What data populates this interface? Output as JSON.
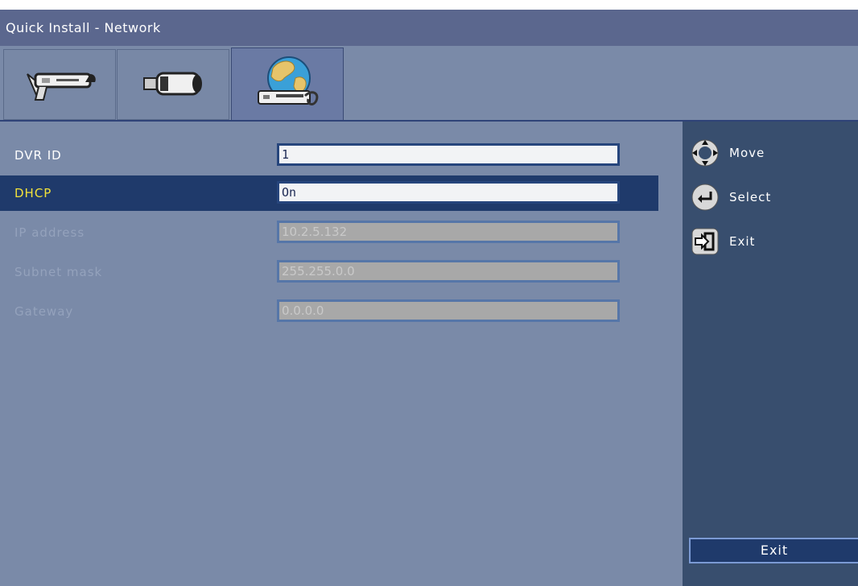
{
  "window": {
    "title": "Quick Install - Network"
  },
  "tabs": [
    {
      "icon": "wrench-dvr-icon",
      "active": false
    },
    {
      "icon": "camera-icon",
      "active": false
    },
    {
      "icon": "globe-network-icon",
      "active": true
    }
  ],
  "form": {
    "rows": [
      {
        "label": "DVR ID",
        "value": "1",
        "state": "normal"
      },
      {
        "label": "DHCP",
        "value": "On",
        "state": "selected"
      },
      {
        "label": "IP address",
        "value": "10.2.5.132",
        "state": "disabled"
      },
      {
        "label": "Subnet mask",
        "value": "255.255.0.0",
        "state": "disabled"
      },
      {
        "label": "Gateway",
        "value": "0.0.0.0",
        "state": "disabled"
      }
    ]
  },
  "hints": [
    {
      "icon": "move-dpad-icon",
      "label": "Move"
    },
    {
      "icon": "enter-select-icon",
      "label": "Select"
    },
    {
      "icon": "exit-door-icon",
      "label": "Exit"
    }
  ],
  "exit_button": {
    "label": "Exit"
  },
  "colors": {
    "background": "#7a8aa8",
    "titlebar": "#5b678e",
    "selected_row": "#1f3a6b",
    "selected_label": "#f2e23a",
    "side_panel": "#384e6e"
  }
}
